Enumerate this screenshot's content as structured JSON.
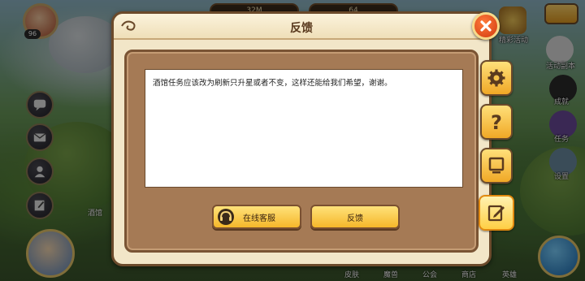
{
  "dialog": {
    "title": "反馈",
    "feedback_text": "酒馆任务应该改为刷新只升星或者不变，这样还能给我们希望，谢谢。",
    "service_button_label": "在线客服",
    "submit_button_label": "反馈"
  },
  "hud": {
    "player_level": "96",
    "resource_1": "32M",
    "resource_2": "64",
    "left_label": "酒馆",
    "right_menu": [
      "活动副本",
      "成就",
      "任务",
      "设置"
    ],
    "top_right_label": "精彩活动",
    "bottom_labels": [
      "皮肤",
      "魔兽",
      "公会",
      "商店",
      "英雄"
    ]
  },
  "tabs": [
    "settings",
    "help",
    "screen",
    "feedback"
  ],
  "colors": {
    "dialog_bg": "#f2e6c8",
    "frame_brown": "#a57a55",
    "button_yellow": "#f5b72a",
    "close_red": "#d03a10"
  }
}
